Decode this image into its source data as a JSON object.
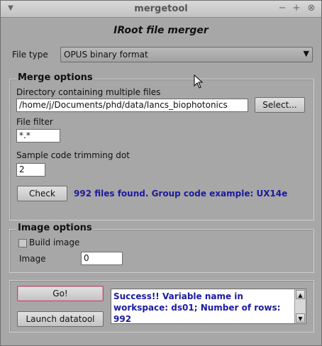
{
  "window": {
    "title": "mergetool",
    "menu_glyph": "▼",
    "minimize_glyph": "−",
    "maximize_glyph": "+",
    "close_glyph": "⊗"
  },
  "app": {
    "heading": "IRoot file merger"
  },
  "file_type": {
    "label": "File type",
    "selected": "OPUS binary format",
    "arrow": "▼"
  },
  "merge_options": {
    "title": "Merge options",
    "directory_label": "Directory containing multiple files",
    "directory_value": "/home/j/Documents/phd/data/lancs_biophotonics",
    "select_button": "Select...",
    "filter_label": "File filter",
    "filter_value": "*.*",
    "trimming_label": "Sample code trimming dot",
    "trimming_value": "2",
    "check_button": "Check",
    "status_text": "992 files found. Group code example: UX14e"
  },
  "image_options": {
    "title": "Image options",
    "build_image_label": "Build image",
    "build_image_checked": false,
    "image_label": "Image",
    "image_value": "0"
  },
  "actions": {
    "go_button": "Go!",
    "launch_button": "Launch datatool",
    "output_text": "Success!! Variable name in workspace: ds01; Number of rows: 992",
    "scroll_up": "▲",
    "scroll_down": "▼"
  }
}
